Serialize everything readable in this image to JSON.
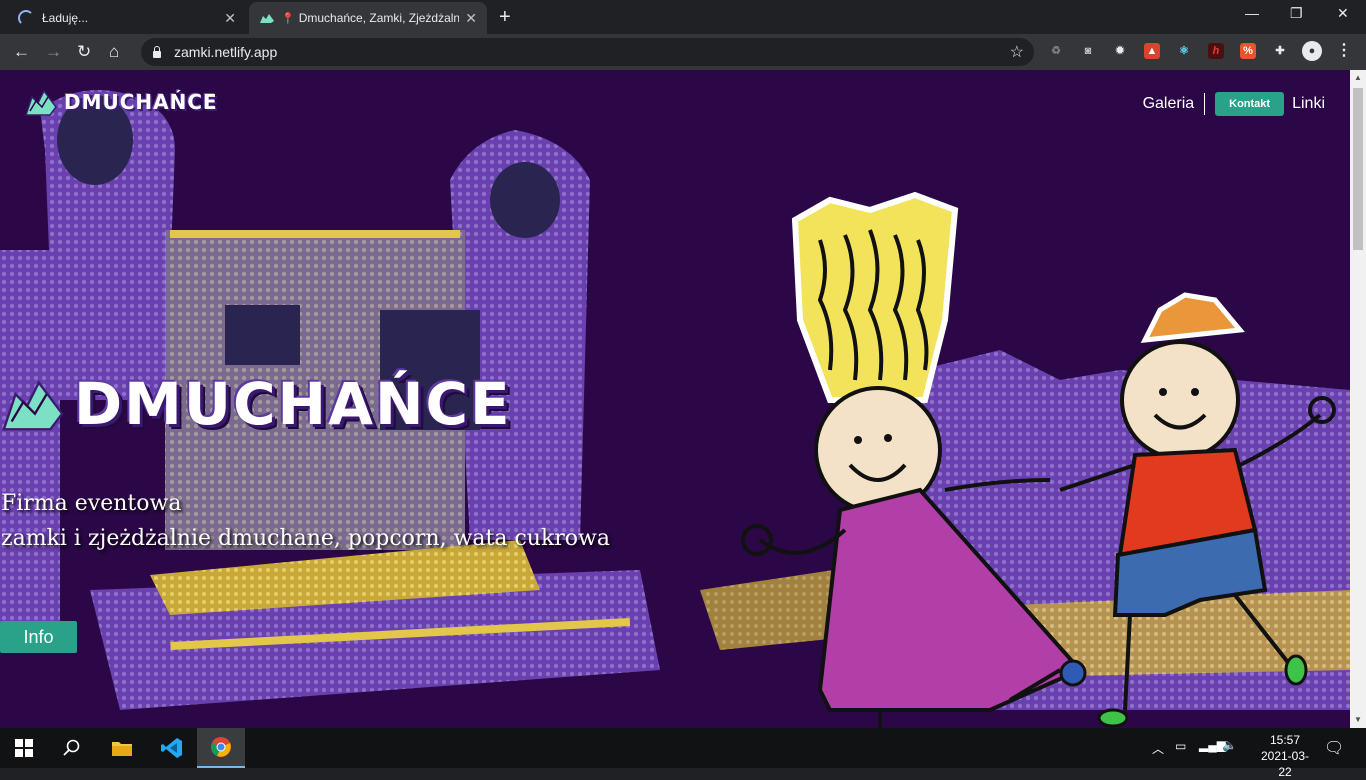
{
  "browser": {
    "tabs": [
      {
        "title": "Ładuję...",
        "state": "loading"
      },
      {
        "title": "Dmuchańce, Zamki, Zjeżdżalnie",
        "state": "active"
      }
    ],
    "address": "zamki.netlify.app",
    "window_controls": {
      "minimize": "—",
      "restore": "❐",
      "close": "✕"
    }
  },
  "site": {
    "logo_text": "DMUCHAŃCE",
    "nav": {
      "gallery": "Galeria",
      "contact": "Kontakt",
      "links": "Linki"
    },
    "hero": {
      "title": "DMUCHAŃCE",
      "subtitle_line1": "Firma eventowa",
      "subtitle_line2": "zamki i zjeżdżalnie dmuchane, popcorn, wata cukrowa",
      "info_button": "Info"
    },
    "colors": {
      "accent": "#2aa189",
      "background": "#2b0747"
    }
  },
  "taskbar": {
    "time": "15:57",
    "date": "2021-03-22",
    "apps": [
      "windows-start",
      "search",
      "file-explorer",
      "vscode",
      "chrome"
    ]
  }
}
